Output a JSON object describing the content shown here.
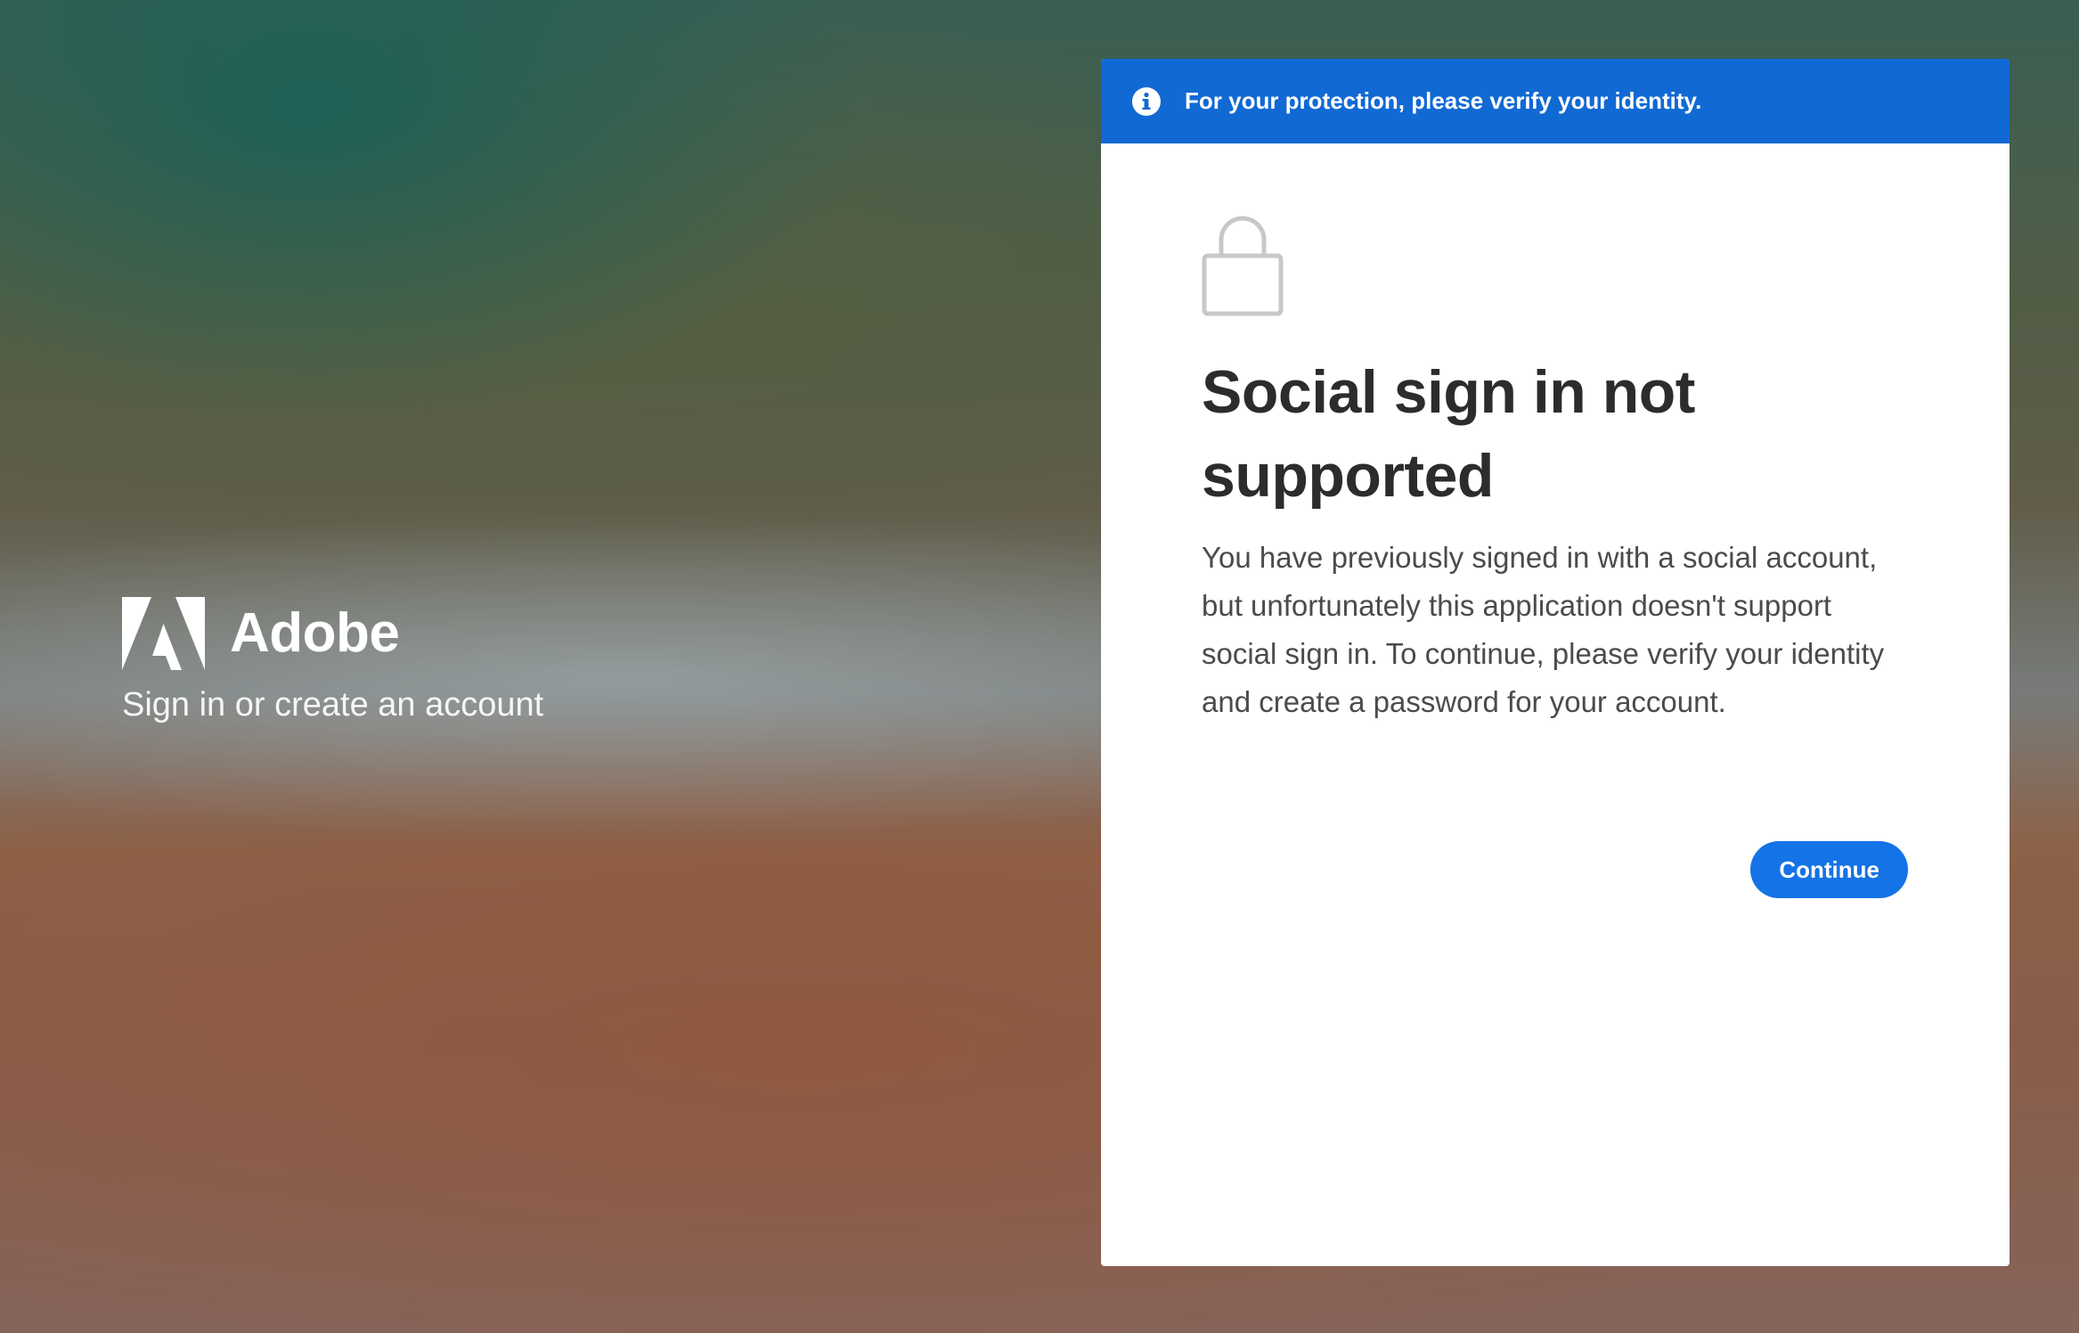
{
  "brand": {
    "name": "Adobe",
    "tagline": "Sign in or create an account"
  },
  "banner": {
    "message": "For your protection, please verify your identity.",
    "icon": "info-icon",
    "color": "#1169d4"
  },
  "main": {
    "icon": "lock-icon",
    "title": "Social sign in not supported",
    "description": "You have previously signed in with a social account, but unfortunately this application doesn't support social sign in. To continue, please verify your identity and create a password for your account.",
    "continue_label": "Continue",
    "button_color": "#1473e6"
  }
}
